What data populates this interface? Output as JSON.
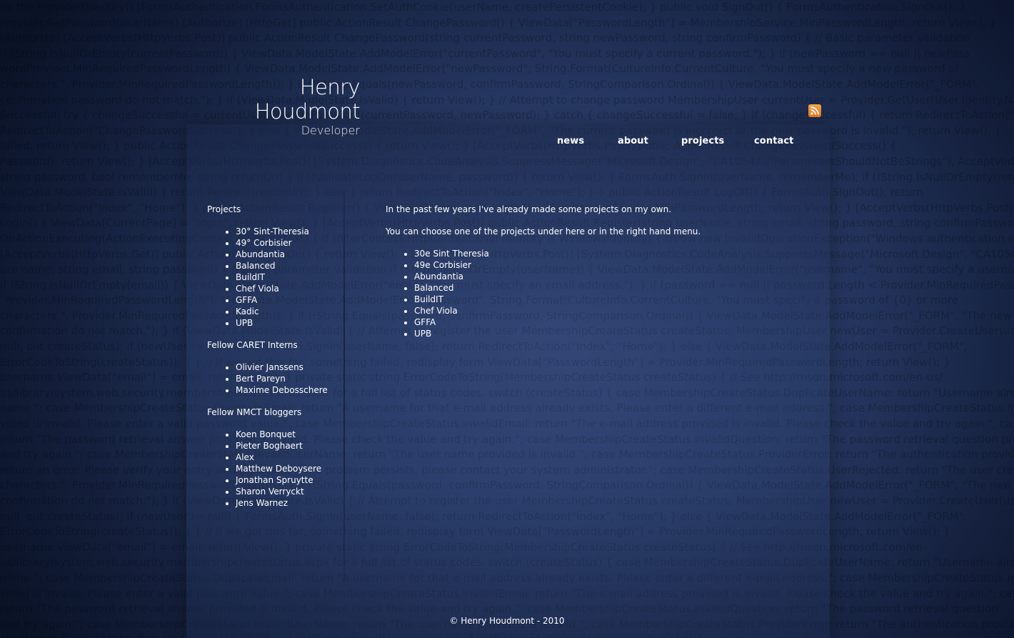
{
  "header": {
    "title": "Henry Houdmont",
    "subtitle": "Developer",
    "rss_icon": "rss-feed-icon"
  },
  "nav": {
    "items": [
      {
        "label": "news"
      },
      {
        "label": "about"
      },
      {
        "label": "projects"
      },
      {
        "label": "contact"
      }
    ]
  },
  "sidebar": {
    "sections": [
      {
        "heading": "Projects",
        "items": [
          "30° Sint-Theresia",
          "49° Corbisier",
          "Abundantia",
          "Balanced",
          "BuildIT",
          "Chef Viola",
          "GFFA",
          "Kadic",
          "UPB"
        ]
      },
      {
        "heading": "Fellow CARET Interns",
        "items": [
          "Olivier Janssens",
          "Bert Pareyn",
          "Maxime Debosschere"
        ]
      },
      {
        "heading": "Fellow NMCT bloggers",
        "items": [
          "Koen Bonquet",
          "Pieter Boghaert",
          "Alex",
          "Matthew Deboysere",
          "Jonathan Spruytte",
          "Sharon Verryckt",
          "Jens Warnez"
        ]
      }
    ]
  },
  "content": {
    "intro": "In the past few years I've already made some projects on my own.",
    "instruction": "You can choose one of the projects under here or in the right hand menu.",
    "projects": [
      "30e Sint Theresia",
      "49e Corbisier",
      "Abundantia",
      "Balanced",
      "BuildIT",
      "Chef Viola",
      "GFFA",
      "UPB"
    ]
  },
  "footer": {
    "text": "© Henry Houdmont - 2010"
  },
  "background_code": [
    "ex the ProviderUserKey)) [FormsAuthentication.FormsAuthentication.SetAuthCookie(userName, createPersistentCookie); } public void SignOut() { FormsAuthentication.SignOut(); }",
    "Provider.GetPassword(userName) [Authorize] [HttpGet] public ActionResult ChangePassword() { ViewData[\"PasswordLength\"] = MembershipService.MinPasswordLength; return View(); }",
    "[Authorize] [AcceptVerbs(HttpVerbs.Post)] public ActionResult ChangePassword(string currentPassword, string newPassword, string confirmPassword) { // Basic parameter validation",
    "if (String.IsNullOrEmpty(currentPassword)) { ViewData.ModelState.AddModelError(\"currentPassword\", \"You must specify a current password.\"); } if (newPassword == null || newPass",
    "wordProvider.MinRequiredPasswordLength) { ViewData.ModelState.AddModelError(\"newPassword\", String.Format(CultureInfo.CurrentCulture, \"You must specify a new password of",
    "characters.\", Provider.MinRequiredPasswordLength)); } if (!String.Equals(newPassword, confirmPassword, StringComparison.Ordinal)) { ViewData.ModelState.AddModelError(\"_FORM\",",
    "confirmation password do not match.\"); } if (ViewData.ModelState.IsValid) { return View(); } // Attempt to change password MembershipUser currentUser = Provider.GetUser(User.Identity.Name, true); bool",
    "Successful; try { changeSuccessful = currentUser.ChangePassword(currentPassword, newPassword); } catch { changeSuccessful = false; } if (changeSuccessful) { return RedirectToAction(\"ChangePasswordSuccess\"); } else",
    "RedirectToAction(\"ChangePasswordSuccess\"); } else { ViewData.ModelState.AddModelError(\"_FORM\", \"The current password is incorrect or the new password is invalid.\"); return View(); }",
    "failed. return View(); } public ActionResult ChangePasswordSuccess() { return View(); } [AcceptVerbs(HttpVerbs.Post)] public ActionResult ChangePasswordSuccess() {",
    "Password); return View(); } [AcceptVerbs(HttpVerbs.Post)] [System.Diagnostics.CodeAnalysis.SuppressMessage(\"Microsoft.Design\", \"CA1054:UriParametersShouldNotBeStrings\"), AcceptVerbs(HttpVerbs.Post)] public ActionResult LogOn(string",
    "string password, bool rememberMe, string returnUrl) { if (!ValidateLogOn(userName, password)) { return View(); } FormsAuth.SignIn(userName, rememberMe); if (!String.IsNullOrEmpty(returnUrl)) {",
    "ViewData.ModelState.IsValid) { return Redirect(returnUrl); } else { return RedirectToAction(\"Index\", \"Home\"); } } public ActionResult LogOff() { FormsAuth.SignOut(); return",
    "RedirectToAction(\"Index\", \"Home\"); } public ActionResult Register() { ViewData[\"PasswordLength\"] = MembershipService.MinPasswordLength; return View(); } [AcceptVerbs(HttpVerbs.Post)] public ActionResult",
    "Login() { ViewData[CurrentPage] = \"login\"; return View(); } [AcceptVerbs(HttpVerbs.Post)] public ActionResult Register(string userName, string email, string password, string confirmPassword) {",
    "OnActionExecuting(ActionExecutingContext filterContext) { if (filterContext.HttpContext.User.Identity is WindowsIdentity) { throw new InvalidOperationException(\"Windows authentication is not supported.\"); }",
    "[AcceptVerbs(HttpVerbs.Get)] public ActionResult LogOn() { return View(); } [AcceptVerbs(HttpVerbs.Post)] [System.Diagnostics.CodeAnalysis.SuppressMessage(\"Microsoft.Design\", \"CA1054\")]",
    "ure name, string email, string password) { // Basic parameter validation if (String.IsNullOrEmpty(userName)) { ViewData.ModelState.AddModelError(\"username\", \"You must specify a username.\"); }",
    "if (String.IsNullOrEmpty(email)) { ViewData.ModelState.AddModelError(\"email\", \"You must specify an email address.\"); } if (password == null || password.Length < Provider.MinRequiredPasswordLength) {",
    "\"Provider.MinRequiredPasswordLength\"); ViewData.ModelState.AddModelError(\"password\", String.Format(CultureInfo.CurrentCulture, \"You must specify a password of {0} or more",
    "characters.\", Provider.MinRequiredPasswordLength)); } if (!String.Equals(password, confirmPassword, StringComparison.Ordinal)) { ViewData.ModelState.AddModelError(\"_FORM\", \"The new password and",
    "confirmation do not match.\"); } if (ViewData.ModelState.IsValid) { // Attempt to register the user MembershipCreateStatus createStatus; MembershipUser newUser = Provider.CreateUser(userName, password, email,",
    "null, out createStatus); if (newUser != null) { FormsAuth.SignIn(userName, false); return RedirectToAction(\"Index\", \"Home\"); } else { ViewData.ModelState.AddModelError(\"_FORM\",",
    "ErrorCodeToString(createStatus)); } } // If we got this far, something failed, redisplay form ViewData[\"PasswordLength\"] = Provider.MinRequiredPasswordLength; return View(); }",
    "username.ViewData[\"email\"] = email; return View(); } private static string ErrorCodeToString(MembershipCreateStatus createStatus) { // See http://msdn.microsoft.com/en-us/",
    "us/library/system.web.security.membershipcreatestatus.aspx for a full list of status codes. switch (createStatus) { case MembershipCreateStatus.DuplicateUserName: return \"Username already exists.",
    "name.\"; case MembershipCreateStatus.DuplicateEmail: return \"A username for that e-mail address already exists. Please enter a different e-mail address.\"; case MembershipCreateStatus.InvalidPassword: return \"The password",
    "vided is invalid. Please enter a valid password value.\"; case MembershipCreateStatus.InvalidEmail: return \"The e-mail address provided is invalid. Please check the value and try again.\"; case Members",
    "return \"The password retrieval answer provided is invalid. Please check the value and try again.\"; case MembershipCreateStatus.InvalidQuestion: return \"The password retrieval question provided",
    "and try again.\"; case MembershipCreateStatus.InvalidUserName: return \"The user name provided is invalid.\"; case MembershipCreateStatus.ProviderError: return \"The authentication provider returned an error.",
    "return an error. Please verify your entry and try again. If the problem persists, please contact your system administrator.\"; case MembershipCreateStatus.UserRejected: return \"The user creation",
    "characters.\", Provider.MinRequiredPasswordLength)); } if (!String.Equals(password, confirmPassword, StringComparison.Ordinal)) { ViewData.ModelState.AddModelError(\"_FORM\", \"The new password and confirmation",
    "confirmation do not match.\"); } if (ViewData.ModelState.IsValid) { // Attempt to register the user MembershipCreateStatus createStatus; MembershipUser newUser = Provider.CreateUser(userName, password, email,",
    "null, out createStatus); if (newUser != null) { FormsAuth.SignIn(userName, false); return RedirectToAction(\"Index\", \"Home\"); } else { ViewData.ModelState.AddModelError(\"_FORM\",",
    "ErrorCodeToString(createStatus)); } } // If we got this far, something failed, redisplay form ViewData[\"PasswordLength\"] = Provider.MinRequiredPasswordLength; return View(); }",
    "username.ViewData[\"email\"] = email; return View(); } private static string ErrorCodeToString(MembershipCreateStatus createStatus) { // See http://msdn.microsoft.com/en-",
    "us/library/system.web.security.membershipcreatestatus.aspx for a full list of status codes. switch (createStatus) { case MembershipCreateStatus.DuplicateUserName: return \"Username already exists.",
    "name.\"; case MembershipCreateStatus.DuplicateEmail: return \"A username for that e-mail address already exists. Please enter a different e-mail address.\"; case MembershipCreateStatus.InvalidPassword: return",
    "vided is invalid. Please enter a valid password value.\"; case MembershipCreateStatus.InvalidEmail: return \"The e-mail address provided is invalid. Please check the value and try again.\"; case Membe",
    "return \"The password retrieval answer provided is invalid. Please check the value and try again.\"; case MembershipCreateStatus.InvalidQuestion: return \"The password retrieval question",
    "and try again.\"; case MembershipCreateStatus.InvalidUserName: return \"The user name provided is invalid.\"; case MembershipCreateStatus.ProviderError: return \"The authentication provider",
    "characters.\", Provider.MinRequiredPasswordLength)); } if (!String.Equals(password, confirmPassword, StringComparison.Ordinal)) {"
  ]
}
